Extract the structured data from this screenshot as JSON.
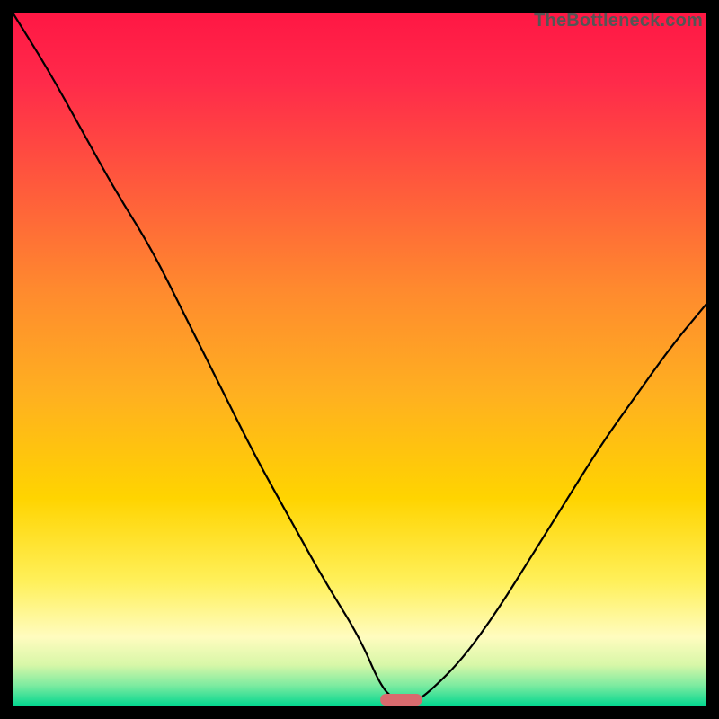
{
  "watermark": "TheBottleneck.com",
  "chart_data": {
    "type": "line",
    "title": "",
    "xlabel": "",
    "ylabel": "",
    "xlim": [
      0,
      100
    ],
    "ylim": [
      0,
      100
    ],
    "grid": false,
    "legend": false,
    "series": [
      {
        "name": "bottleneck-curve",
        "x": [
          0,
          5,
          10,
          15,
          20,
          25,
          30,
          35,
          40,
          45,
          50,
          53,
          55,
          57,
          60,
          65,
          70,
          75,
          80,
          85,
          90,
          95,
          100
        ],
        "y": [
          100,
          92,
          83,
          74,
          66,
          56,
          46,
          36,
          27,
          18,
          10,
          3,
          1,
          0,
          2,
          7,
          14,
          22,
          30,
          38,
          45,
          52,
          58
        ]
      }
    ],
    "marker": {
      "x": 56,
      "y": 0,
      "width_pct": 6,
      "color": "#d86a6e"
    },
    "gradient_stops": [
      {
        "offset": 0.0,
        "color": "#ff1744"
      },
      {
        "offset": 0.1,
        "color": "#ff2a4a"
      },
      {
        "offset": 0.25,
        "color": "#ff5a3c"
      },
      {
        "offset": 0.4,
        "color": "#ff8a2e"
      },
      {
        "offset": 0.55,
        "color": "#ffb020"
      },
      {
        "offset": 0.7,
        "color": "#ffd400"
      },
      {
        "offset": 0.82,
        "color": "#fff05a"
      },
      {
        "offset": 0.9,
        "color": "#fffcbf"
      },
      {
        "offset": 0.94,
        "color": "#d8f7a8"
      },
      {
        "offset": 0.97,
        "color": "#7ceba0"
      },
      {
        "offset": 1.0,
        "color": "#00d68f"
      }
    ]
  }
}
